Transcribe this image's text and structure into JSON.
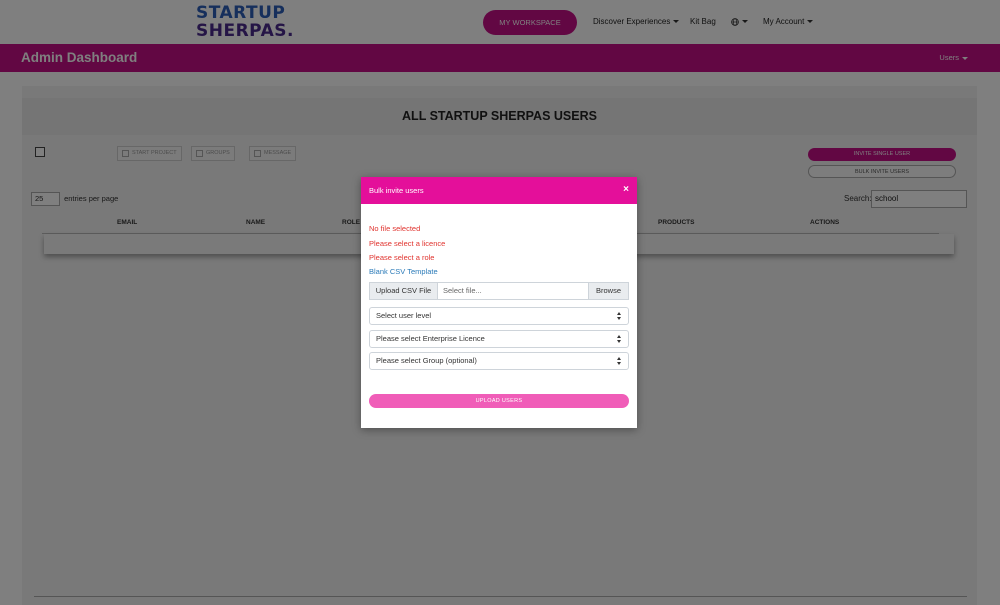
{
  "nav": {
    "logo_line1": "STARTUP",
    "logo_line2": "SHERPAS.",
    "workspace_label": "MY WORKSPACE",
    "discover_label": "Discover Experiences",
    "kitbag_label": "Kit Bag",
    "globe_icon": "globe-icon",
    "account_label": "My Account"
  },
  "adminbar": {
    "title": "Admin Dashboard",
    "users_menu": "Users"
  },
  "page": {
    "heading": "ALL STARTUP SHERPAS USERS",
    "actions": [
      "START PROJECT",
      "GROUPS",
      "MESSAGE"
    ],
    "invite_single": "INVITE SINGLE USER",
    "bulk_invite": "BULK INVITE USERS",
    "entries_value": "25",
    "entries_label": "entries per page",
    "search_label": "Search:",
    "search_value": "school",
    "columns": [
      "EMAIL",
      "NAME",
      "ROLE",
      "PRODUCTS",
      "ACTIONS"
    ]
  },
  "modal": {
    "title": "Bulk invite users",
    "close": "×",
    "errors": [
      "No file selected",
      "Please select a licence",
      "Please select a role"
    ],
    "template_link": "Blank CSV Template",
    "file_label": "Upload CSV File",
    "file_placeholder": "Select file...",
    "browse_label": "Browse",
    "user_level": "Select user level",
    "enterprise_licence": "Please select Enterprise Licence",
    "group": "Please select Group (optional)",
    "upload_button": "UPLOAD USERS"
  },
  "colors": {
    "brand_magenta": "#c40e86",
    "modal_header": "#e40f9a",
    "upload_button": "#f05db8",
    "error_red": "#e0332e",
    "link_blue": "#2a7ab8"
  }
}
